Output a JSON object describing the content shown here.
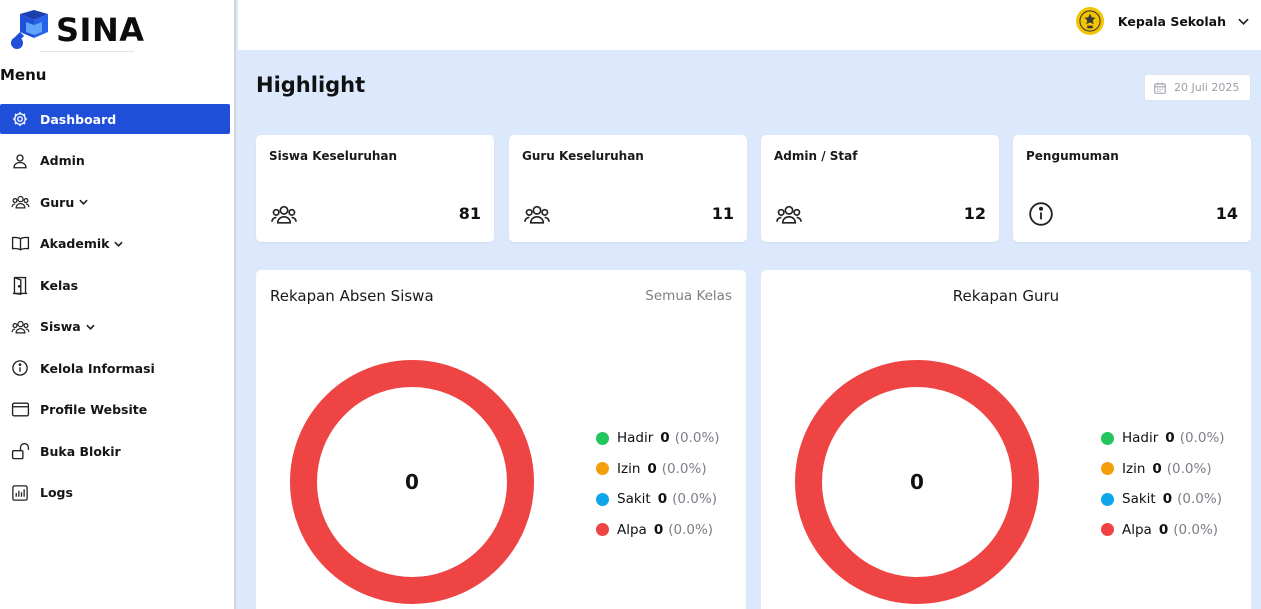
{
  "brand": {
    "name": "SINA"
  },
  "sidebar": {
    "menu_title": "Menu",
    "items": [
      {
        "label": "Dashboard",
        "icon": "gear-icon",
        "active": true
      },
      {
        "label": "Admin",
        "icon": "user-icon"
      },
      {
        "label": "Guru",
        "icon": "group-icon",
        "has_dropdown": true
      },
      {
        "label": "Akademik",
        "icon": "book-icon",
        "has_dropdown": true
      },
      {
        "label": "Kelas",
        "icon": "door-icon"
      },
      {
        "label": "Siswa",
        "icon": "group-icon",
        "has_dropdown": true
      },
      {
        "label": "Kelola Informasi",
        "icon": "info-icon"
      },
      {
        "label": "Profile Website",
        "icon": "browser-window-icon"
      },
      {
        "label": "Buka Blokir",
        "icon": "unlock-icon"
      },
      {
        "label": "Logs",
        "icon": "bar-chart-icon"
      }
    ]
  },
  "topbar": {
    "user_label": "Kepala Sekolah"
  },
  "main": {
    "title": "Highlight",
    "date": "20 Juli 2025",
    "stats": [
      {
        "label": "Siswa Keseluruhan",
        "value": "81",
        "icon": "group-icon"
      },
      {
        "label": "Guru Keseluruhan",
        "value": "11",
        "icon": "group-icon"
      },
      {
        "label": "Admin / Staf",
        "value": "12",
        "icon": "group-icon"
      },
      {
        "label": "Pengumuman",
        "value": "14",
        "icon": "info-icon"
      }
    ],
    "panels": [
      {
        "title": "Rekapan Absen Siswa",
        "filter": "Semua Kelas",
        "total": "0",
        "legend": [
          {
            "label": "Hadir",
            "count": "0",
            "percent": "(0.0%)",
            "color": "#22c55e"
          },
          {
            "label": "Izin",
            "count": "0",
            "percent": "(0.0%)",
            "color": "#f59e0b"
          },
          {
            "label": "Sakit",
            "count": "0",
            "percent": "(0.0%)",
            "color": "#0ea5e9"
          },
          {
            "label": "Alpa",
            "count": "0",
            "percent": "(0.0%)",
            "color": "#ef4444"
          }
        ]
      },
      {
        "title": "Rekapan Guru",
        "total": "0",
        "legend": [
          {
            "label": "Hadir",
            "count": "0",
            "percent": "(0.0%)",
            "color": "#22c55e"
          },
          {
            "label": "Izin",
            "count": "0",
            "percent": "(0.0%)",
            "color": "#f59e0b"
          },
          {
            "label": "Sakit",
            "count": "0",
            "percent": "(0.0%)",
            "color": "#0ea5e9"
          },
          {
            "label": "Alpa",
            "count": "0",
            "percent": "(0.0%)",
            "color": "#ef4444"
          }
        ]
      }
    ]
  },
  "colors": {
    "accent": "#1f4fd8",
    "donut": "#ef4444",
    "background": "#dce8fb"
  }
}
